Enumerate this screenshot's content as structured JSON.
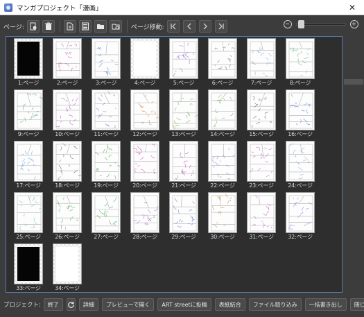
{
  "window": {
    "title": "マンガプロジェクト「漫画」",
    "close_glyph": "✕"
  },
  "toolbar": {
    "page_label": "ページ:",
    "page_move_label": "ページ移動:",
    "icons": [
      "page-settings-icon",
      "trash-icon",
      "document-icon",
      "document-lines-icon",
      "folder-open-icon",
      "folder-refresh-icon"
    ],
    "nav_icons": [
      "first-page-icon",
      "prev-page-icon",
      "next-page-icon",
      "last-page-icon"
    ],
    "zoom_level": 0.03
  },
  "pages": [
    {
      "label": "1:ページ",
      "type": "black"
    },
    {
      "label": "2:ページ",
      "type": "sketch",
      "color": "#d36bb8"
    },
    {
      "label": "3:ページ",
      "type": "sketch",
      "color": "#6a8de0"
    },
    {
      "label": "4:ページ",
      "type": "blank"
    },
    {
      "label": "5:ページ",
      "type": "sketch",
      "color": "#9b7fd8"
    },
    {
      "label": "6:ページ",
      "type": "sketch",
      "color": "#8a8a8a"
    },
    {
      "label": "7:ページ",
      "type": "sketch",
      "color": "#8fb0d8"
    },
    {
      "label": "8:ページ",
      "type": "sketch",
      "color": "#6cc08a"
    },
    {
      "label": "9:ページ",
      "type": "sketch",
      "color": "#58b36e"
    },
    {
      "label": "10:ページ",
      "type": "sketch",
      "color": "#c85fc0"
    },
    {
      "label": "11:ページ",
      "type": "sketch",
      "color": "#a080c8"
    },
    {
      "label": "12:ページ",
      "type": "sketch",
      "color": "#d89a5a"
    },
    {
      "label": "13:ページ",
      "type": "sketch",
      "color": "#8cc060"
    },
    {
      "label": "14:ページ",
      "type": "sketch",
      "color": "#7cbf5a"
    },
    {
      "label": "15:ページ",
      "type": "sketch",
      "color": "#6b6b6b"
    },
    {
      "label": "16:ページ",
      "type": "sketch",
      "color": "#6e8ed8"
    },
    {
      "label": "17:ページ",
      "type": "sketch",
      "color": "#7fb0e0"
    },
    {
      "label": "18:ページ",
      "type": "sketch",
      "color": "#7a7a7a"
    },
    {
      "label": "19:ページ",
      "type": "sketch",
      "color": "#5ab65a"
    },
    {
      "label": "20:ページ",
      "type": "sketch",
      "color": "#d860c8"
    },
    {
      "label": "21:ページ",
      "type": "sketch",
      "color": "#c266c8"
    },
    {
      "label": "22:ページ",
      "type": "sketch",
      "color": "#8a9ae0"
    },
    {
      "label": "23:ページ",
      "type": "sketch",
      "color": "#d070d0"
    },
    {
      "label": "24:ページ",
      "type": "sketch",
      "color": "#9ab0e0"
    },
    {
      "label": "25:ページ",
      "type": "sketch",
      "color": "#7ec8b8"
    },
    {
      "label": "26:ページ",
      "type": "sketch",
      "color": "#6ab86a"
    },
    {
      "label": "27:ページ",
      "type": "sketch",
      "color": "#60b860"
    },
    {
      "label": "28:ページ",
      "type": "sketch",
      "color": "#b07ac8"
    },
    {
      "label": "29:ページ",
      "type": "sketch",
      "color": "#6d8fd8"
    },
    {
      "label": "30:ページ",
      "type": "sketch",
      "color": "#c89a50"
    },
    {
      "label": "31:ページ",
      "type": "sketch",
      "color": "#d07ad0"
    },
    {
      "label": "32:ページ",
      "type": "sketch",
      "color": "#a58be0"
    },
    {
      "label": "33:ページ",
      "type": "black"
    },
    {
      "label": "34:ページ",
      "type": "blank"
    }
  ],
  "bottombar": {
    "project_label": "プロジェクト:",
    "end_button": "終了",
    "refresh_icon": "refresh-icon",
    "details_button": "詳細",
    "preview_button": "プレビューで開く",
    "art_street_button": "ART streetに投稿",
    "cover_button": "表紙結合",
    "import_button": "ファイル取り込み",
    "export_button": "一括書き出し",
    "close_button": "閉じる"
  }
}
